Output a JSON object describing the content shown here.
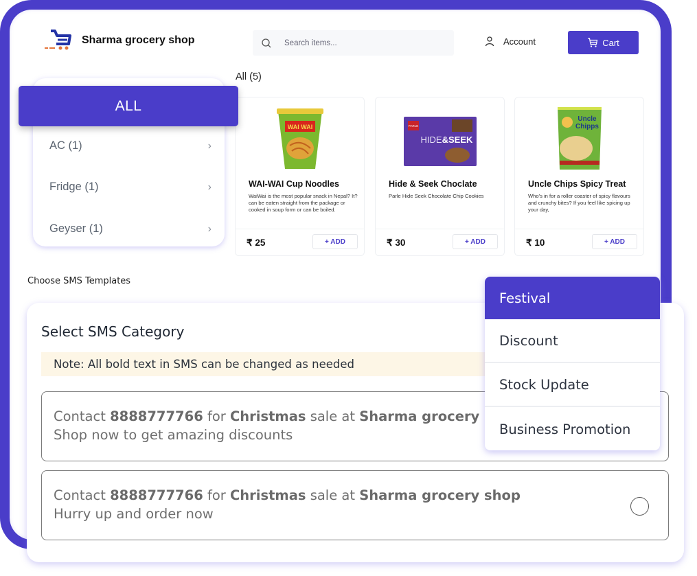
{
  "header": {
    "shop_name": "Sharma grocery shop",
    "logo_icon": "cart-logo-icon",
    "search": {
      "placeholder": "Search items...",
      "value": ""
    },
    "account_label": "Account",
    "cart_label": "Cart"
  },
  "categories": {
    "items": [
      {
        "label": "ALL",
        "active": true
      },
      {
        "label": "AC (1)"
      },
      {
        "label": "Fridge (1)"
      },
      {
        "label": "Geyser (1)"
      }
    ]
  },
  "products": {
    "heading": "All (5)",
    "items": [
      {
        "title": "WAI-WAI Cup Noodles",
        "description": "WaiWai is the most popular snack in Nepal? It?can be eaten straight from the package or cooked in soup form or can be boiled.",
        "price": "₹ 25",
        "add_label": "+ ADD",
        "image": "wai-wai-cup-noodles"
      },
      {
        "title": "Hide & Seek Choclate",
        "description": "Parle Hide Seek Chocolate Chip Cookies",
        "price": "₹ 30",
        "add_label": "+ ADD",
        "image": "hide-and-seek-pack"
      },
      {
        "title": "Uncle Chips Spicy Treat",
        "description": "Who's in for a roller coaster of spicy flavours and crunchy bites? If you feel like spicing up your day,",
        "price": "₹ 10",
        "add_label": "+ ADD",
        "image": "uncle-chipps-pack"
      }
    ]
  },
  "sms": {
    "section_title": "Choose SMS Templates",
    "heading": "Select SMS Category",
    "note": "Note: All bold text in SMS can be changed as needed",
    "templates": [
      {
        "parts": [
          "Contact ",
          "8888777766",
          " for ",
          "Christmas",
          " sale at ",
          "Sharma grocery shop"
        ],
        "line2": "Shop now to get amazing discounts",
        "selected": false
      },
      {
        "parts": [
          "Contact ",
          "8888777766",
          " for ",
          "Christmas",
          " sale at ",
          "Sharma grocery shop"
        ],
        "line2": "Hurry up and order now",
        "selected": false
      }
    ],
    "category_dropdown": {
      "selected": "Festival",
      "options": [
        "Festival",
        "Discount",
        "Stock Update",
        "Business Promotion"
      ]
    }
  },
  "colors": {
    "accent": "#4a3dc9",
    "note_bg": "#fdf6e6"
  }
}
